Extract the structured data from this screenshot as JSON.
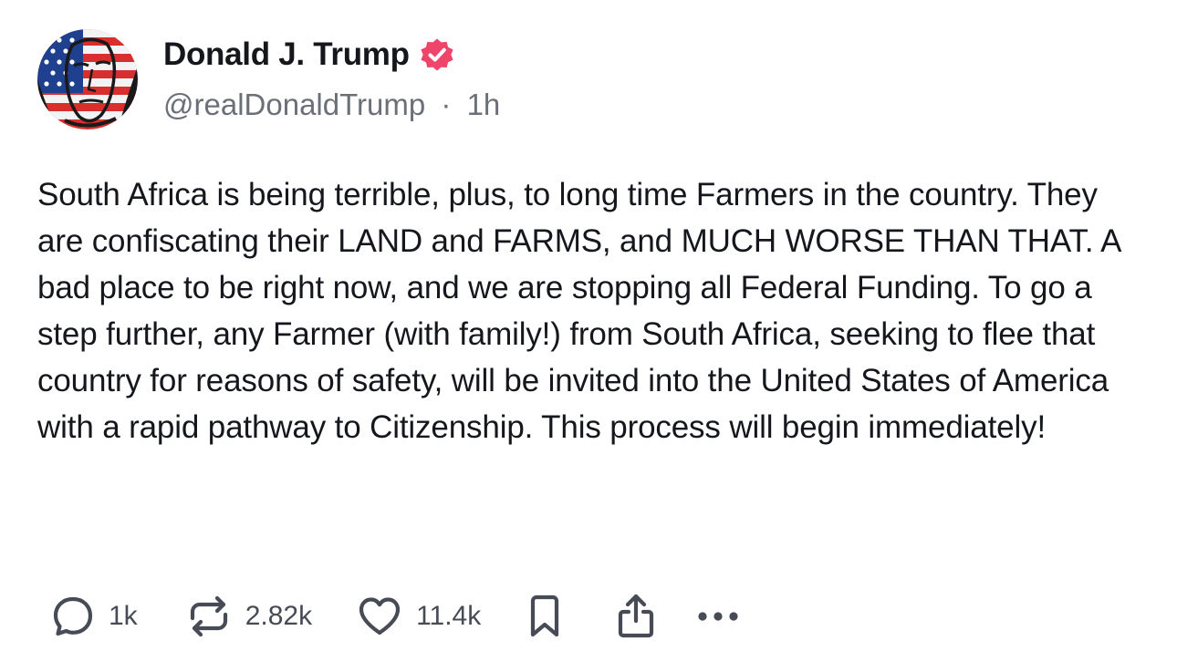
{
  "author": {
    "display_name": "Donald J. Trump",
    "verified_icon": "verified-badge-icon",
    "handle": "@realDonaldTrump",
    "separator": "·",
    "time": "1h",
    "avatar_icon": "avatar-portrait"
  },
  "post": {
    "text": "South Africa is being terrible, plus, to long time Farmers in the country. They are confiscating their LAND and FARMS, and MUCH WORSE THAN THAT. A bad place to be right now, and we are stopping all Federal Funding. To go a step further, any Farmer (with family!) from South Africa, seeking to flee that country for reasons of safety, will be invited into the United States of America with a rapid pathway to Citizenship. This process will begin immediately!"
  },
  "actions": {
    "reply": {
      "icon": "reply-icon",
      "count": "1k"
    },
    "repost": {
      "icon": "repost-icon",
      "count": "2.82k"
    },
    "like": {
      "icon": "heart-icon",
      "count": "11.4k"
    },
    "bookmark": {
      "icon": "bookmark-icon"
    },
    "share": {
      "icon": "share-icon"
    },
    "more": {
      "icon": "more-icon"
    }
  },
  "colors": {
    "verified_badge": "#f0456b",
    "text_primary": "#15171c",
    "text_secondary": "#6b6f78",
    "icon_gray": "#474b55"
  }
}
